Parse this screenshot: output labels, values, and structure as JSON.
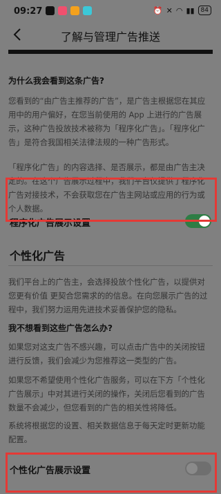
{
  "status": {
    "time": "09:27",
    "battery": "84",
    "app_colors": [
      "#111111",
      "#f0506e",
      "#f4a11d",
      "#3cc8d8"
    ]
  },
  "header": {
    "title": "了解与管理广告推送"
  },
  "section1": {
    "question": "为什么我会看到这条广告?",
    "para1": "您看到的“由广告主推荐的广告”，是广告主根据您在其应用中的用户偏好，在您当前使用的 App 上进行的广告展示，这种广告投放技术被称为「程序化广告」。「程序化广告」是符合我国相关法律法规的一种广告形式。",
    "para2": "「程序化广告」的内容选择、是否展示，都是由广告主决定的。在这个广告展示过程中，我们平台仅提供了程序化广告对接技术，不会获取您在广告主网站或应用的行为或个人数据。",
    "toggle_label": "程序化广告展示设置",
    "toggle_on": true
  },
  "section2": {
    "title": "个性化广告",
    "para1": "我们平台上的广告主，会选择投放个性化广告，以提供对您更有价值 更契合您需求的的信息。在向您展示广告的过程中，我们努力运用先进技术妥善保护您的隐私。",
    "question": "我不想看到这些广告怎么办?",
    "para2": "如果您对这支广告不感兴趣，可以点击广告中的关闭按钮进行反馈，我们会减少为您推荐这一类型的广告。",
    "para3": "如果您不希望使用个性化广告服务，可以在下方「个性化广告展示」中对其进行关闭的操作，关闭后您看到的广告数量不会减少，但您看到的广告的相关性将降低。",
    "para4": "系统将根据您的设置、相关数据信息于每天定时更新功能配置。",
    "toggle_label": "个性化广告展示设置",
    "toggle_on": false
  },
  "colors": {
    "highlight": "#e53935",
    "toggle_on": "#2e7d45",
    "background": "#808080"
  }
}
